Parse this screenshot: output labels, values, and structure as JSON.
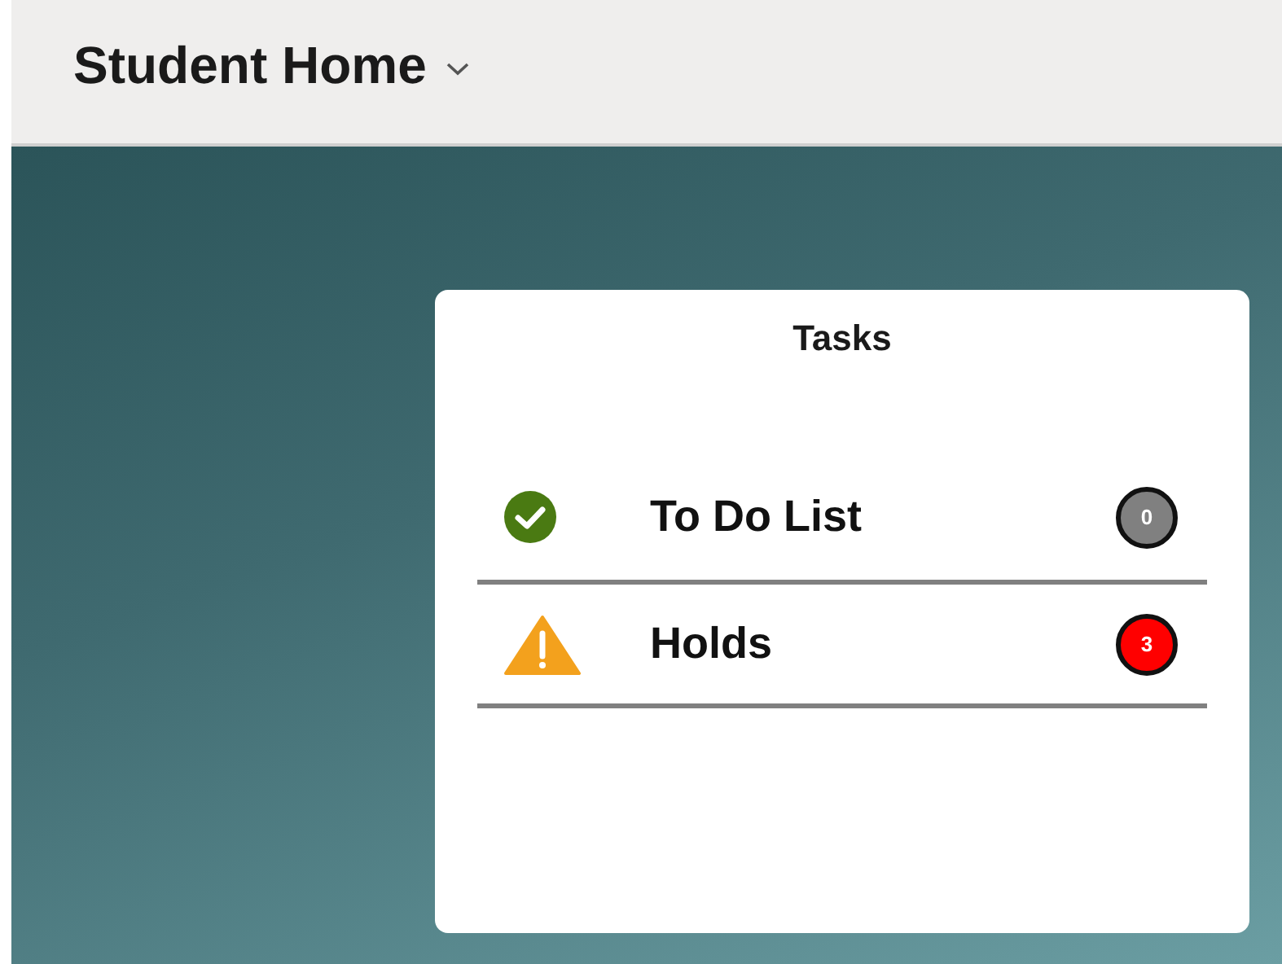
{
  "header": {
    "title": "Student Home"
  },
  "tasks": {
    "title": "Tasks",
    "items": [
      {
        "label": "To Do List",
        "kind": "done",
        "count": "0",
        "color": "#808080"
      },
      {
        "label": "Holds",
        "kind": "warning",
        "count": "3",
        "color": "#ff0000"
      }
    ]
  }
}
